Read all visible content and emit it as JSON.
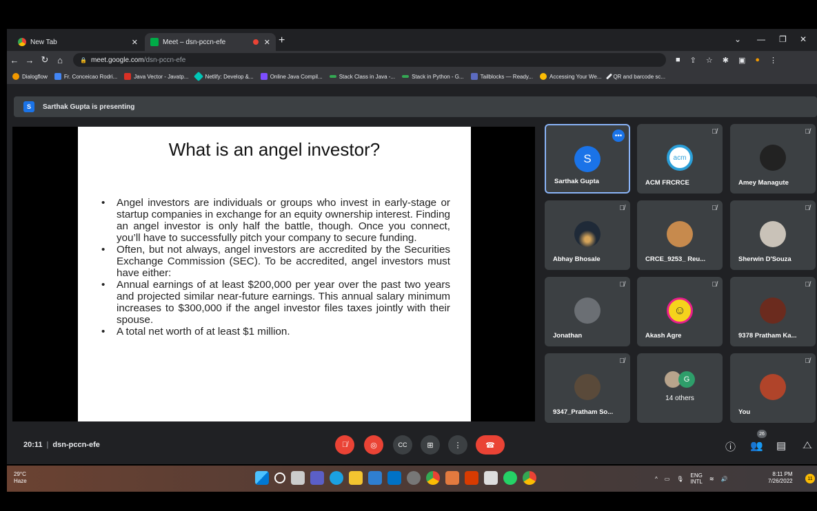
{
  "browser": {
    "tabs": [
      {
        "label": "New Tab",
        "icon": "chrome-icon"
      },
      {
        "label": "Meet – dsn-pccn-efe",
        "icon": "meet-icon"
      }
    ],
    "new_tab_label": "+",
    "url_domain": "meet.google.com",
    "url_path": "/dsn-pccn-efe",
    "bookmarks": [
      {
        "label": "Dialogflow",
        "color": "#f29900"
      },
      {
        "label": "Fr. Conceicao Rodri...",
        "color": "#4285f4"
      },
      {
        "label": "Java Vector - Javatp...",
        "color": "#d93025"
      },
      {
        "label": "Netlify: Develop &...",
        "color": "#00c7b7"
      },
      {
        "label": "Online Java Compil...",
        "color": "#7c4dff"
      },
      {
        "label": "Stack Class in Java -...",
        "color": "#34a853"
      },
      {
        "label": "Stack in Python - G...",
        "color": "#34a853"
      },
      {
        "label": "Tailblocks — Ready...",
        "color": "#5c6bc0"
      },
      {
        "label": "Accessing Your We...",
        "color": "#fbbc04"
      },
      {
        "label": "QR and barcode sc...",
        "color": "#e8eaed"
      }
    ]
  },
  "meet": {
    "presenting_badge": "S",
    "presenting_text": "Sarthak Gupta is presenting",
    "slide": {
      "title": "What is an angel investor?",
      "bullets": [
        "Angel investors are individuals or groups who invest in early-stage or startup companies in exchange for an equity ownership interest. Finding an angel investor is only half the battle, though. Once you connect, you’ll have to successfully pitch your company to secure funding.",
        "Often, but not always, angel investors are accredited by the Securities Exchange Commission (SEC). To be accredited, angel investors must have either:",
        "Annual earnings of at least $200,000 per year over the past two years and projected similar near-future earnings. This annual salary minimum increases to $300,000 if the angel investor files taxes jointly with their spouse.",
        "A total net worth of at least $1 million."
      ]
    },
    "participants": [
      {
        "name": "Sarthak Gupta",
        "initial": "S",
        "color": "#1a73e8"
      },
      {
        "name": "ACM FRCRCE",
        "initial": "acm",
        "color": "#2b9fd8"
      },
      {
        "name": "Amey Managute",
        "initial": "",
        "color": "#222222"
      },
      {
        "name": "Abhay Bhosale",
        "initial": "",
        "color": "#1f2a38"
      },
      {
        "name": "CRCE_9253_ Reu...",
        "initial": "",
        "color": "#c78a4d"
      },
      {
        "name": "Sherwin D'Souza",
        "initial": "",
        "color": "#c9c2b8"
      },
      {
        "name": "Jonathan",
        "initial": "",
        "color": "#6b6f74"
      },
      {
        "name": "Akash Agre",
        "initial": "☺",
        "color": "#f5d31c"
      },
      {
        "name": "9378 Pratham Ka...",
        "initial": "",
        "color": "#6b2b1e"
      },
      {
        "name": "9347_Pratham So...",
        "initial": "",
        "color": "#5a4a3a"
      },
      {
        "name": "You",
        "initial": "",
        "color": "#b0442a"
      }
    ],
    "others": {
      "label": "14 others",
      "initial": "G"
    },
    "time": "20:11",
    "meeting_code": "dsn-pccn-efe",
    "participant_count": "26"
  },
  "taskbar": {
    "temperature": "29°C",
    "weather": "Haze",
    "lang": "ENG",
    "layout": "INTL",
    "time": "8:11 PM",
    "date": "7/26/2022",
    "notifications": "11"
  }
}
